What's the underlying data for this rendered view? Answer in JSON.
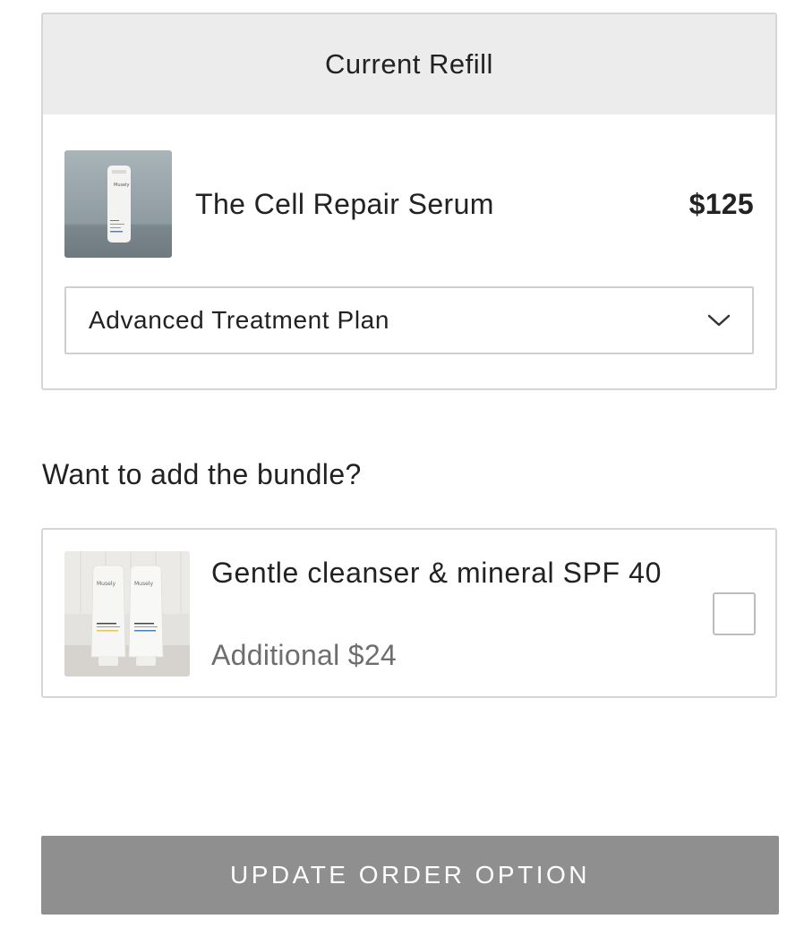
{
  "refill": {
    "header": "Current Refill",
    "product": {
      "name": "The Cell Repair Serum",
      "price": "$125",
      "image_brand": "Musely"
    },
    "plan_select": {
      "selected": "Advanced Treatment Plan"
    }
  },
  "bundle": {
    "prompt": "Want to add the bundle?",
    "name": "Gentle cleanser & mineral SPF 40",
    "price": "Additional $24",
    "image_brand": "Musely",
    "checked": false
  },
  "actions": {
    "update_label": "UPDATE ORDER OPTION"
  },
  "colors": {
    "header_bg": "#ececec",
    "border": "#d6d6d6",
    "button_bg": "#8f8f8f",
    "muted_text": "#6e6e6e"
  },
  "icons": {
    "select": "chevron-down-icon"
  }
}
